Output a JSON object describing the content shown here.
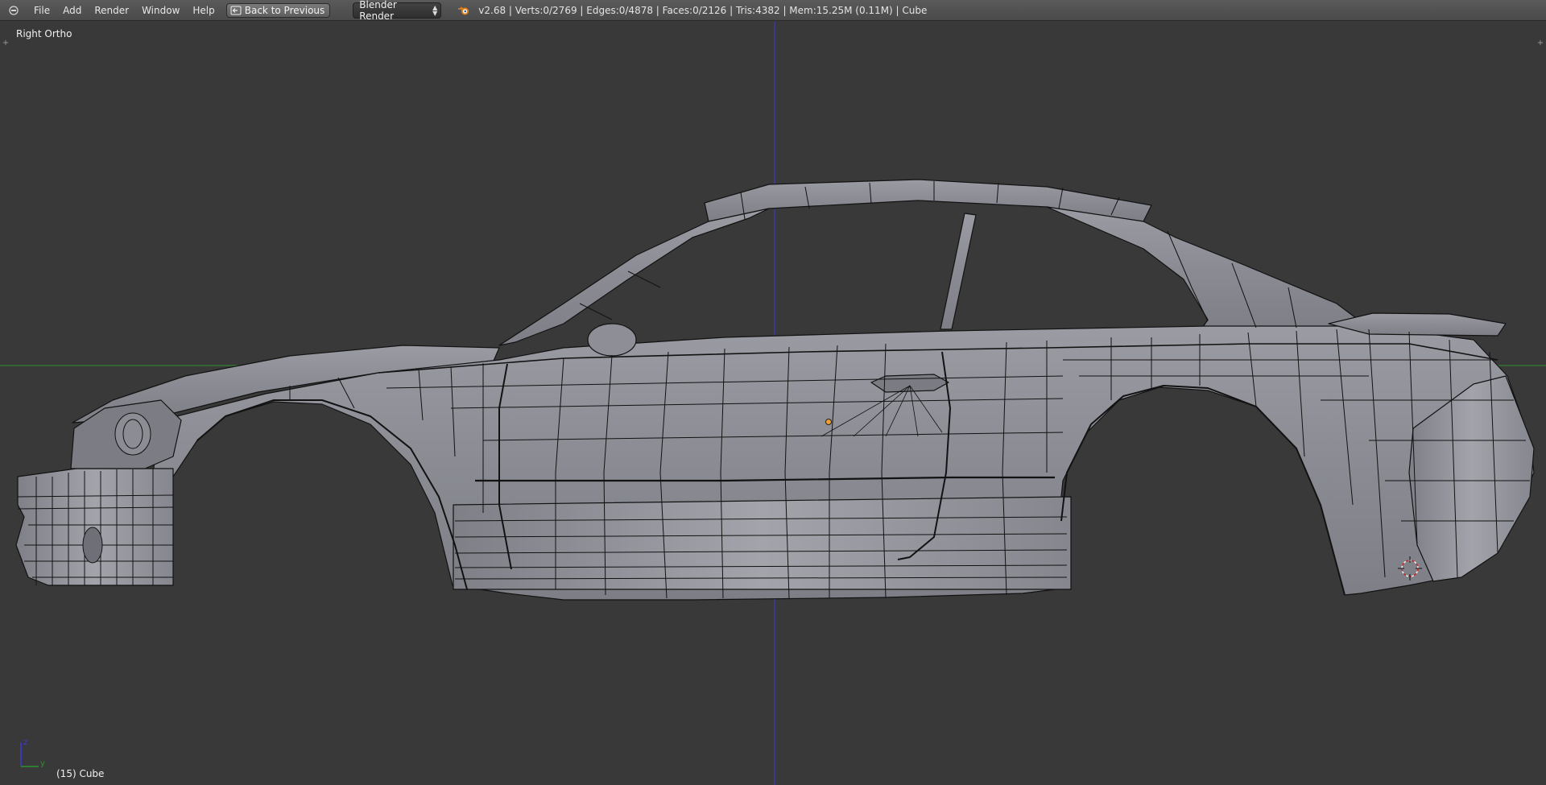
{
  "header": {
    "editor_type_icon": "info-editor-icon",
    "menus": [
      "File",
      "Add",
      "Render",
      "Window",
      "Help"
    ],
    "back_button": {
      "label": "Back to Previous",
      "icon": "back-arrow-icon"
    },
    "render_engine": "Blender Render",
    "logo_icon": "blender-logo-icon",
    "stats": "v2.68 | Verts:0/2769 | Edges:0/4878 | Faces:0/2126 | Tris:4382 | Mem:15.25M (0.11M) | Cube"
  },
  "viewport": {
    "view_name": "Right Ortho",
    "active_object": "(15) Cube",
    "gizmo_axes": {
      "vertical": "z",
      "horizontal": "y"
    },
    "colors": {
      "background": "#393939",
      "mesh_face": "#8a8b93",
      "wire": "#121212",
      "z_axis": "#3b3bd2",
      "y_axis": "#2f8f2f",
      "cursor": "#c42a2a",
      "origin": "#f0a030"
    }
  }
}
